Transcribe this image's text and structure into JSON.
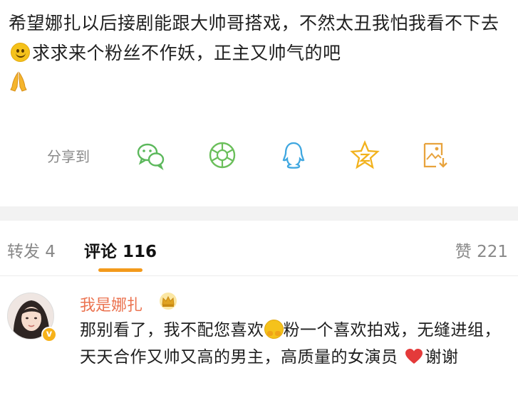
{
  "post": {
    "text_part1": "希望娜扎以后接剧能跟大帅哥搭戏，不然太丑我怕我看不下去",
    "text_part2": "求求来个粉丝不作妖，正主又帅气的吧",
    "emoji_1": "smile-emoji",
    "emoji_2": "pray-emoji"
  },
  "share": {
    "label": "分享到",
    "targets": [
      "wechat-icon",
      "moments-icon",
      "qq-icon",
      "qzone-icon",
      "save-image-icon"
    ]
  },
  "tabs": {
    "repost": "转发 4",
    "comments": "评论 116",
    "likes": "赞 221",
    "active": "comments",
    "accent_color": "#f39a1c"
  },
  "comment": {
    "username": "我是娜扎",
    "username_color": "#eb7350",
    "verified_badge": "v",
    "text_part1": "那别看了，我不配您喜欢",
    "text_part2": "粉一个喜欢拍戏，无缝进组，天天合作又帅又高的男主，高质量的女演员",
    "text_part3": "谢谢"
  }
}
